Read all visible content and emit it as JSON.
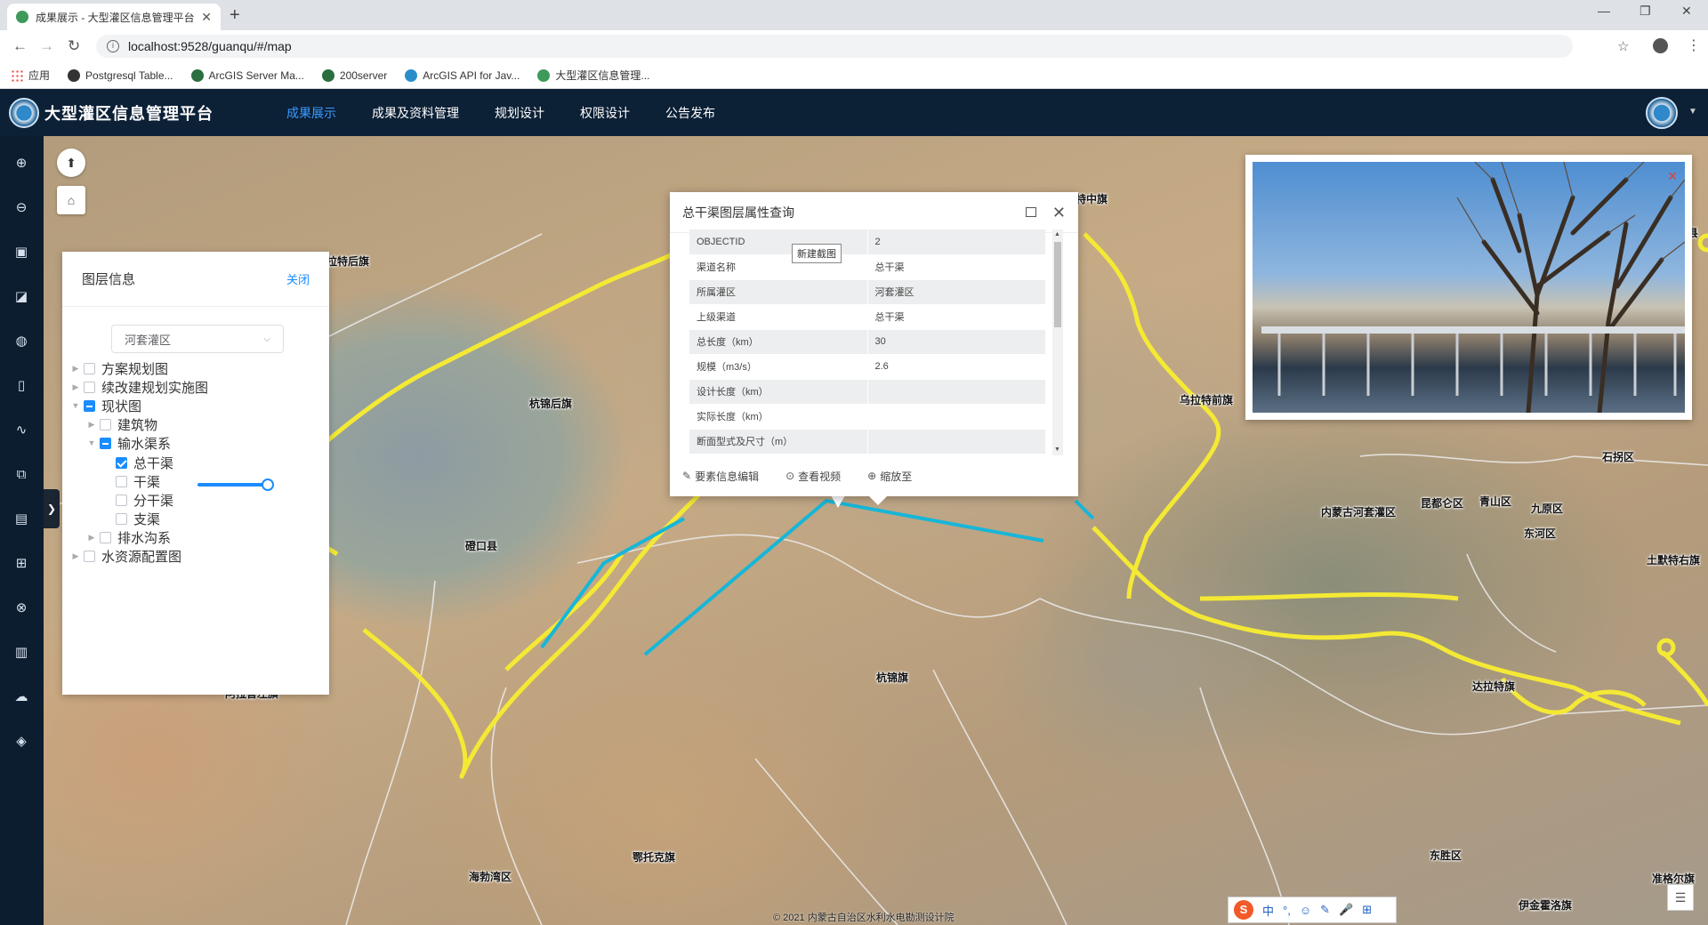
{
  "browser": {
    "tab_title": "成果展示 - 大型灌区信息管理平台",
    "url": "localhost:9528/guanqu/#/map",
    "bookmarks": [
      "应用",
      "Postgresql Table...",
      "ArcGIS Server Ma...",
      "200server",
      "ArcGIS API for Jav...",
      "大型灌区信息管理..."
    ]
  },
  "header": {
    "title": "大型灌区信息管理平台",
    "menu": [
      "成果展示",
      "成果及资料管理",
      "规划设计",
      "权限设计",
      "公告发布"
    ],
    "active_menu": "成果展示"
  },
  "sidebar": {
    "tools": [
      "zoom-in-icon",
      "zoom-out-icon",
      "layer-icon",
      "measure-icon",
      "globe-icon",
      "pin-icon",
      "line-icon",
      "export-icon",
      "ruler-icon",
      "road-icon",
      "wheel-icon",
      "chart-icon",
      "cloud-upload-icon",
      "stack-icon"
    ]
  },
  "layer_panel": {
    "title": "图层信息",
    "close_label": "关闭",
    "selected_area": "河套灌区",
    "tree": [
      {
        "label": "方案规划图",
        "level": 0,
        "state": "unchecked",
        "expandable": true
      },
      {
        "label": "续改建规划实施图",
        "level": 0,
        "state": "unchecked",
        "expandable": true
      },
      {
        "label": "现状图",
        "level": 0,
        "state": "indeterminate",
        "expandable": true,
        "expanded": true
      },
      {
        "label": "建筑物",
        "level": 1,
        "state": "unchecked",
        "expandable": true
      },
      {
        "label": "输水渠系",
        "level": 1,
        "state": "indeterminate",
        "expandable": true,
        "expanded": true
      },
      {
        "label": "总干渠",
        "level": 2,
        "state": "checked",
        "expandable": false,
        "opacity": 1.0
      },
      {
        "label": "干渠",
        "level": 2,
        "state": "unchecked",
        "expandable": false
      },
      {
        "label": "分干渠",
        "level": 2,
        "state": "unchecked",
        "expandable": false
      },
      {
        "label": "支渠",
        "level": 2,
        "state": "unchecked",
        "expandable": false
      },
      {
        "label": "排水沟系",
        "level": 1,
        "state": "unchecked",
        "expandable": true
      },
      {
        "label": "水资源配置图",
        "level": 0,
        "state": "unchecked",
        "expandable": true
      }
    ]
  },
  "popup": {
    "title": "总干渠图层属性查询",
    "tooltip": "新建截图",
    "rows": [
      {
        "key": "OBJECTID",
        "value": "2"
      },
      {
        "key": "渠道名称",
        "value": "总干渠"
      },
      {
        "key": "所属灌区",
        "value": "河套灌区"
      },
      {
        "key": "上级渠道",
        "value": "总干渠"
      },
      {
        "key": "总长度（km）",
        "value": "30"
      },
      {
        "key": "规模（m3/s）",
        "value": "2.6"
      },
      {
        "key": "设计长度（km）",
        "value": ""
      },
      {
        "key": "实际长度（km）",
        "value": ""
      },
      {
        "key": "断面型式及尺寸（m）",
        "value": ""
      }
    ],
    "actions": [
      "要素信息编辑",
      "查看视频",
      "缩放至"
    ]
  },
  "map": {
    "labels": [
      {
        "text": "拉特后旗"
      },
      {
        "text": "杭锦后旗"
      },
      {
        "text": "磴口县"
      },
      {
        "text": "阿拉善左旗"
      },
      {
        "text": "乌拉特前旗"
      },
      {
        "text": "杭锦旗"
      },
      {
        "text": "鄂托克旗"
      },
      {
        "text": "海勃湾区"
      },
      {
        "text": "达拉特旗"
      },
      {
        "text": "东胜区"
      },
      {
        "text": "石拐区"
      },
      {
        "text": "九原区"
      },
      {
        "text": "东河区"
      },
      {
        "text": "昆都仑区"
      },
      {
        "text": "青山区"
      },
      {
        "text": "土默特右旗"
      },
      {
        "text": "准格尔旗"
      },
      {
        "text": "伊金霍洛旗"
      },
      {
        "text": "内蒙古河套灌区"
      },
      {
        "text": "特中旗"
      },
      {
        "text": "县"
      }
    ],
    "copyright": "© 2021 内蒙古自治区水利水电勘测设计院",
    "colors": {
      "irrigation_boundary": "#f4e934",
      "canal": "#17b6d8",
      "admin_boundary": "#e8e8e8"
    }
  },
  "ime": {
    "logo": "S",
    "items": [
      "中",
      "°,",
      "☺",
      "✎",
      "🎤",
      "⊞"
    ]
  }
}
